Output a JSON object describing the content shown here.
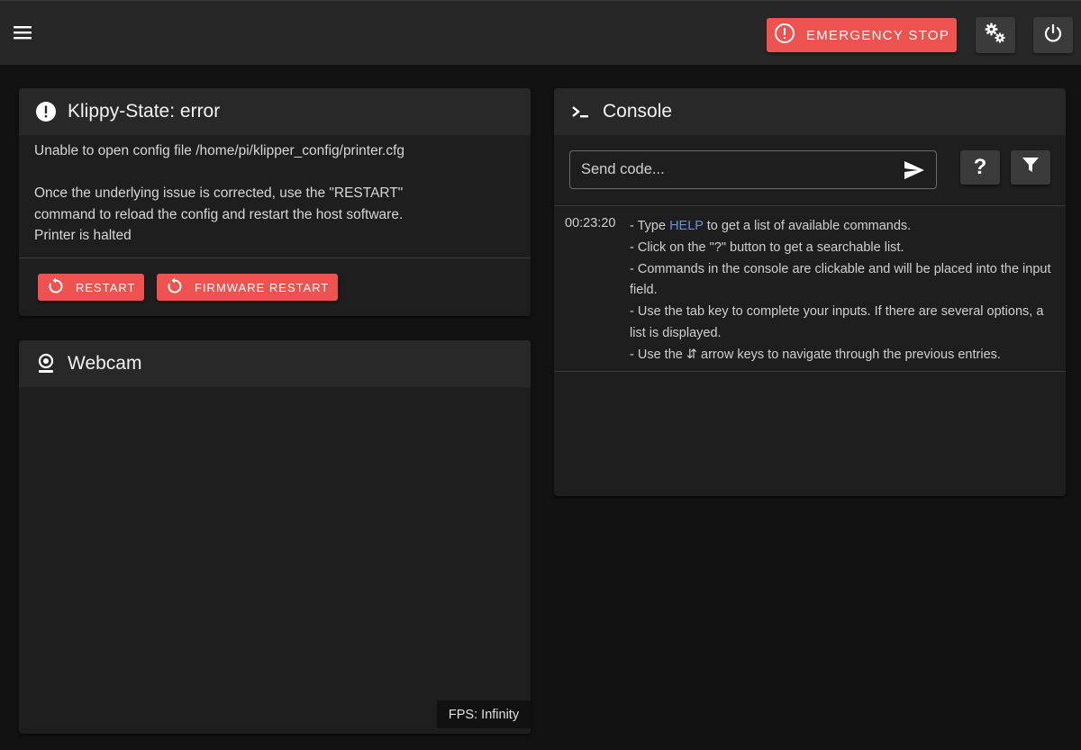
{
  "topbar": {
    "emergency_stop_label": "EMERGENCY STOP",
    "icons": {
      "menu": "menu-icon",
      "settings": "cogs-icon",
      "power": "power-icon"
    }
  },
  "klippy": {
    "title": "Klippy-State: error",
    "icon": "alert-circle-icon",
    "lines": [
      "Unable to open config file /home/pi/klipper_config/printer.cfg",
      "",
      "Once the underlying issue is corrected, use the \"RESTART\"",
      "command to reload the config and restart the host software.",
      "Printer is halted"
    ],
    "restart_label": "RESTART",
    "firmware_restart_label": "FIRMWARE RESTART"
  },
  "webcam": {
    "title": "Webcam",
    "icon": "webcam-icon",
    "fps_label": "FPS: Infinity"
  },
  "console": {
    "title": "Console",
    "icon": "console-prompt-icon",
    "input_placeholder": "Send code...",
    "help_button_label": "?",
    "entry": {
      "time": "00:23:20",
      "line1_pre": "- Type ",
      "line1_link": "HELP",
      "line1_post": " to get a list of available commands.",
      "line2": "- Click on the \"?\" button to get a searchable list.",
      "line3": "- Commands in the console are clickable and will be placed into the input field.",
      "line4": "- Use the tab key to complete your inputs. If there are several options, a list is displayed.",
      "line5_pre": "- Use the ",
      "line5_arrows": "⇵",
      "line5_post": " arrow keys to navigate through the previous entries."
    }
  },
  "colors": {
    "accent_red": "#ef5350",
    "background": "#121212",
    "card": "#1e1e1e",
    "card_header": "#282828",
    "link": "#6d8fd6"
  }
}
